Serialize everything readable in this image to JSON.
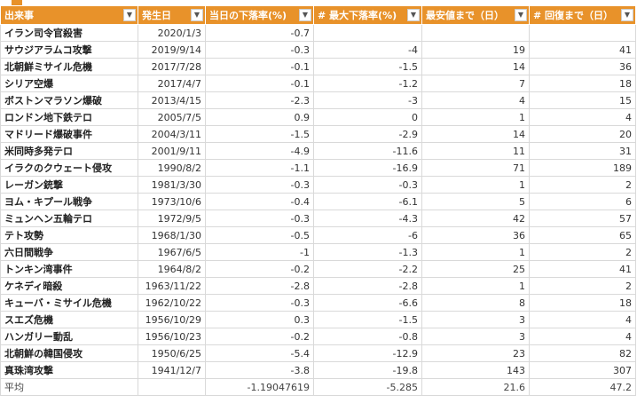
{
  "headers": [
    "出来事",
    "発生日",
    "当日の下落率(%)",
    "# 最大下落率(%)",
    "最安値まで（日）",
    "# 回復まで（日）"
  ],
  "rows": [
    [
      "イラン司令官殺害",
      "2020/1/3",
      "-0.7",
      "",
      "",
      ""
    ],
    [
      "サウジアラムコ攻撃",
      "2019/9/14",
      "-0.3",
      "-4",
      "19",
      "41"
    ],
    [
      "北朝鮮ミサイル危機",
      "2017/7/28",
      "-0.1",
      "-1.5",
      "14",
      "36"
    ],
    [
      "シリア空爆",
      "2017/4/7",
      "-0.1",
      "-1.2",
      "7",
      "18"
    ],
    [
      "ボストンマラソン爆破",
      "2013/4/15",
      "-2.3",
      "-3",
      "4",
      "15"
    ],
    [
      "ロンドン地下鉄テロ",
      "2005/7/5",
      "0.9",
      "0",
      "1",
      "4"
    ],
    [
      "マドリード爆破事件",
      "2004/3/11",
      "-1.5",
      "-2.9",
      "14",
      "20"
    ],
    [
      "米同時多発テロ",
      "2001/9/11",
      "-4.9",
      "-11.6",
      "11",
      "31"
    ],
    [
      "イラクのクウェート侵攻",
      "1990/8/2",
      "-1.1",
      "-16.9",
      "71",
      "189"
    ],
    [
      "レーガン銃撃",
      "1981/3/30",
      "-0.3",
      "-0.3",
      "1",
      "2"
    ],
    [
      "ヨム・キプール戦争",
      "1973/10/6",
      "-0.4",
      "-6.1",
      "5",
      "6"
    ],
    [
      "ミュンヘン五輪テロ",
      "1972/9/5",
      "-0.3",
      "-4.3",
      "42",
      "57"
    ],
    [
      "テト攻勢",
      "1968/1/30",
      "-0.5",
      "-6",
      "36",
      "65"
    ],
    [
      "六日間戦争",
      "1967/6/5",
      "-1",
      "-1.3",
      "1",
      "2"
    ],
    [
      "トンキン湾事件",
      "1964/8/2",
      "-0.2",
      "-2.2",
      "25",
      "41"
    ],
    [
      "ケネディ暗殺",
      "1963/11/22",
      "-2.8",
      "-2.8",
      "1",
      "2"
    ],
    [
      "キューバ・ミサイル危機",
      "1962/10/22",
      "-0.3",
      "-6.6",
      "8",
      "18"
    ],
    [
      "スエズ危機",
      "1956/10/29",
      "0.3",
      "-1.5",
      "3",
      "4"
    ],
    [
      "ハンガリー動乱",
      "1956/10/23",
      "-0.2",
      "-0.8",
      "3",
      "4"
    ],
    [
      "北朝鮮の韓国侵攻",
      "1950/6/25",
      "-5.4",
      "-12.9",
      "23",
      "82"
    ],
    [
      "真珠湾攻撃",
      "1941/12/7",
      "-3.8",
      "-19.8",
      "143",
      "307"
    ]
  ],
  "average": [
    "平均",
    "",
    "-1.19047619",
    "-5.285",
    "21.6",
    "47.2"
  ],
  "colors": {
    "header_bg": "#e8922a",
    "header_text": "#ffffff",
    "grid": "#d9d9d9"
  },
  "icons": {
    "filter": "chevron-down-icon"
  }
}
